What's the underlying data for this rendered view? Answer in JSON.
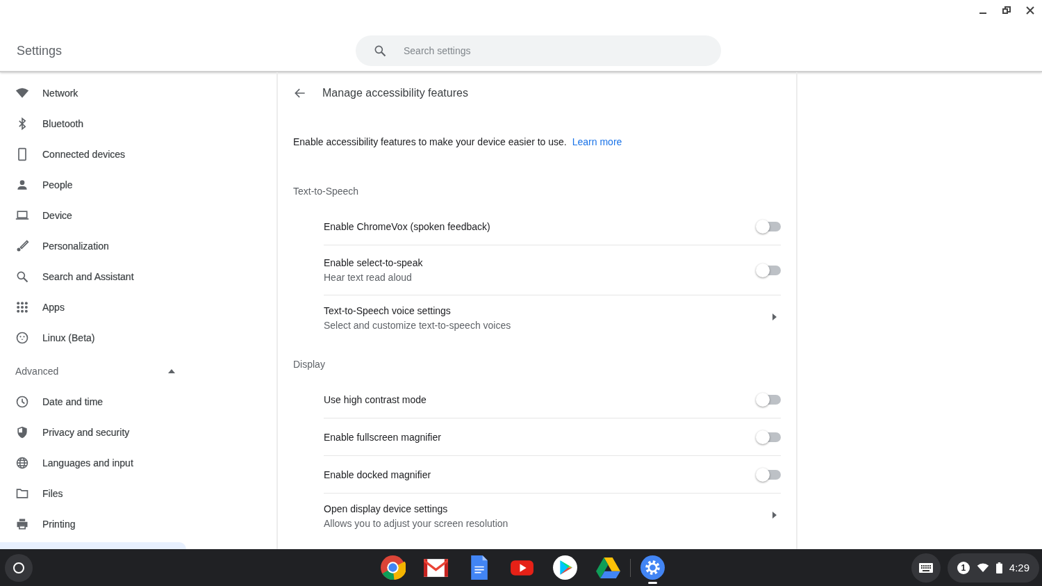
{
  "window": {
    "title": "Settings"
  },
  "search": {
    "placeholder": "Search settings"
  },
  "sidebar": {
    "items": [
      {
        "label": "Network"
      },
      {
        "label": "Bluetooth"
      },
      {
        "label": "Connected devices"
      },
      {
        "label": "People"
      },
      {
        "label": "Device"
      },
      {
        "label": "Personalization"
      },
      {
        "label": "Search and Assistant"
      },
      {
        "label": "Apps"
      },
      {
        "label": "Linux (Beta)"
      }
    ],
    "advanced": {
      "label": "Advanced",
      "expanded": true,
      "items": [
        {
          "label": "Date and time"
        },
        {
          "label": "Privacy and security"
        },
        {
          "label": "Languages and input"
        },
        {
          "label": "Files"
        },
        {
          "label": "Printing"
        }
      ]
    }
  },
  "page": {
    "title": "Manage accessibility features",
    "description": "Enable accessibility features to make your device easier to use.",
    "link": "Learn more",
    "sections": [
      {
        "title": "Text-to-Speech",
        "rows": [
          {
            "kind": "toggle",
            "label": "Enable ChromeVox (spoken feedback)",
            "on": false
          },
          {
            "kind": "toggle",
            "label": "Enable select-to-speak",
            "sublabel": "Hear text read aloud",
            "on": false
          },
          {
            "kind": "link",
            "label": "Text-to-Speech voice settings",
            "sublabel": "Select and customize text-to-speech voices"
          }
        ]
      },
      {
        "title": "Display",
        "rows": [
          {
            "kind": "toggle",
            "label": "Use high contrast mode",
            "on": false
          },
          {
            "kind": "toggle",
            "label": "Enable fullscreen magnifier",
            "on": false
          },
          {
            "kind": "toggle",
            "label": "Enable docked magnifier",
            "on": false
          },
          {
            "kind": "link",
            "label": "Open display device settings",
            "sublabel": "Allows you to adjust your screen resolution"
          }
        ]
      }
    ]
  },
  "shelf": {
    "apps": [
      {
        "active": false
      },
      {
        "active": false
      },
      {
        "active": false
      },
      {
        "active": false
      },
      {
        "active": false
      },
      {
        "active": false
      },
      {
        "active": true
      }
    ],
    "status": {
      "notifications": "1",
      "time": "4:29"
    }
  }
}
